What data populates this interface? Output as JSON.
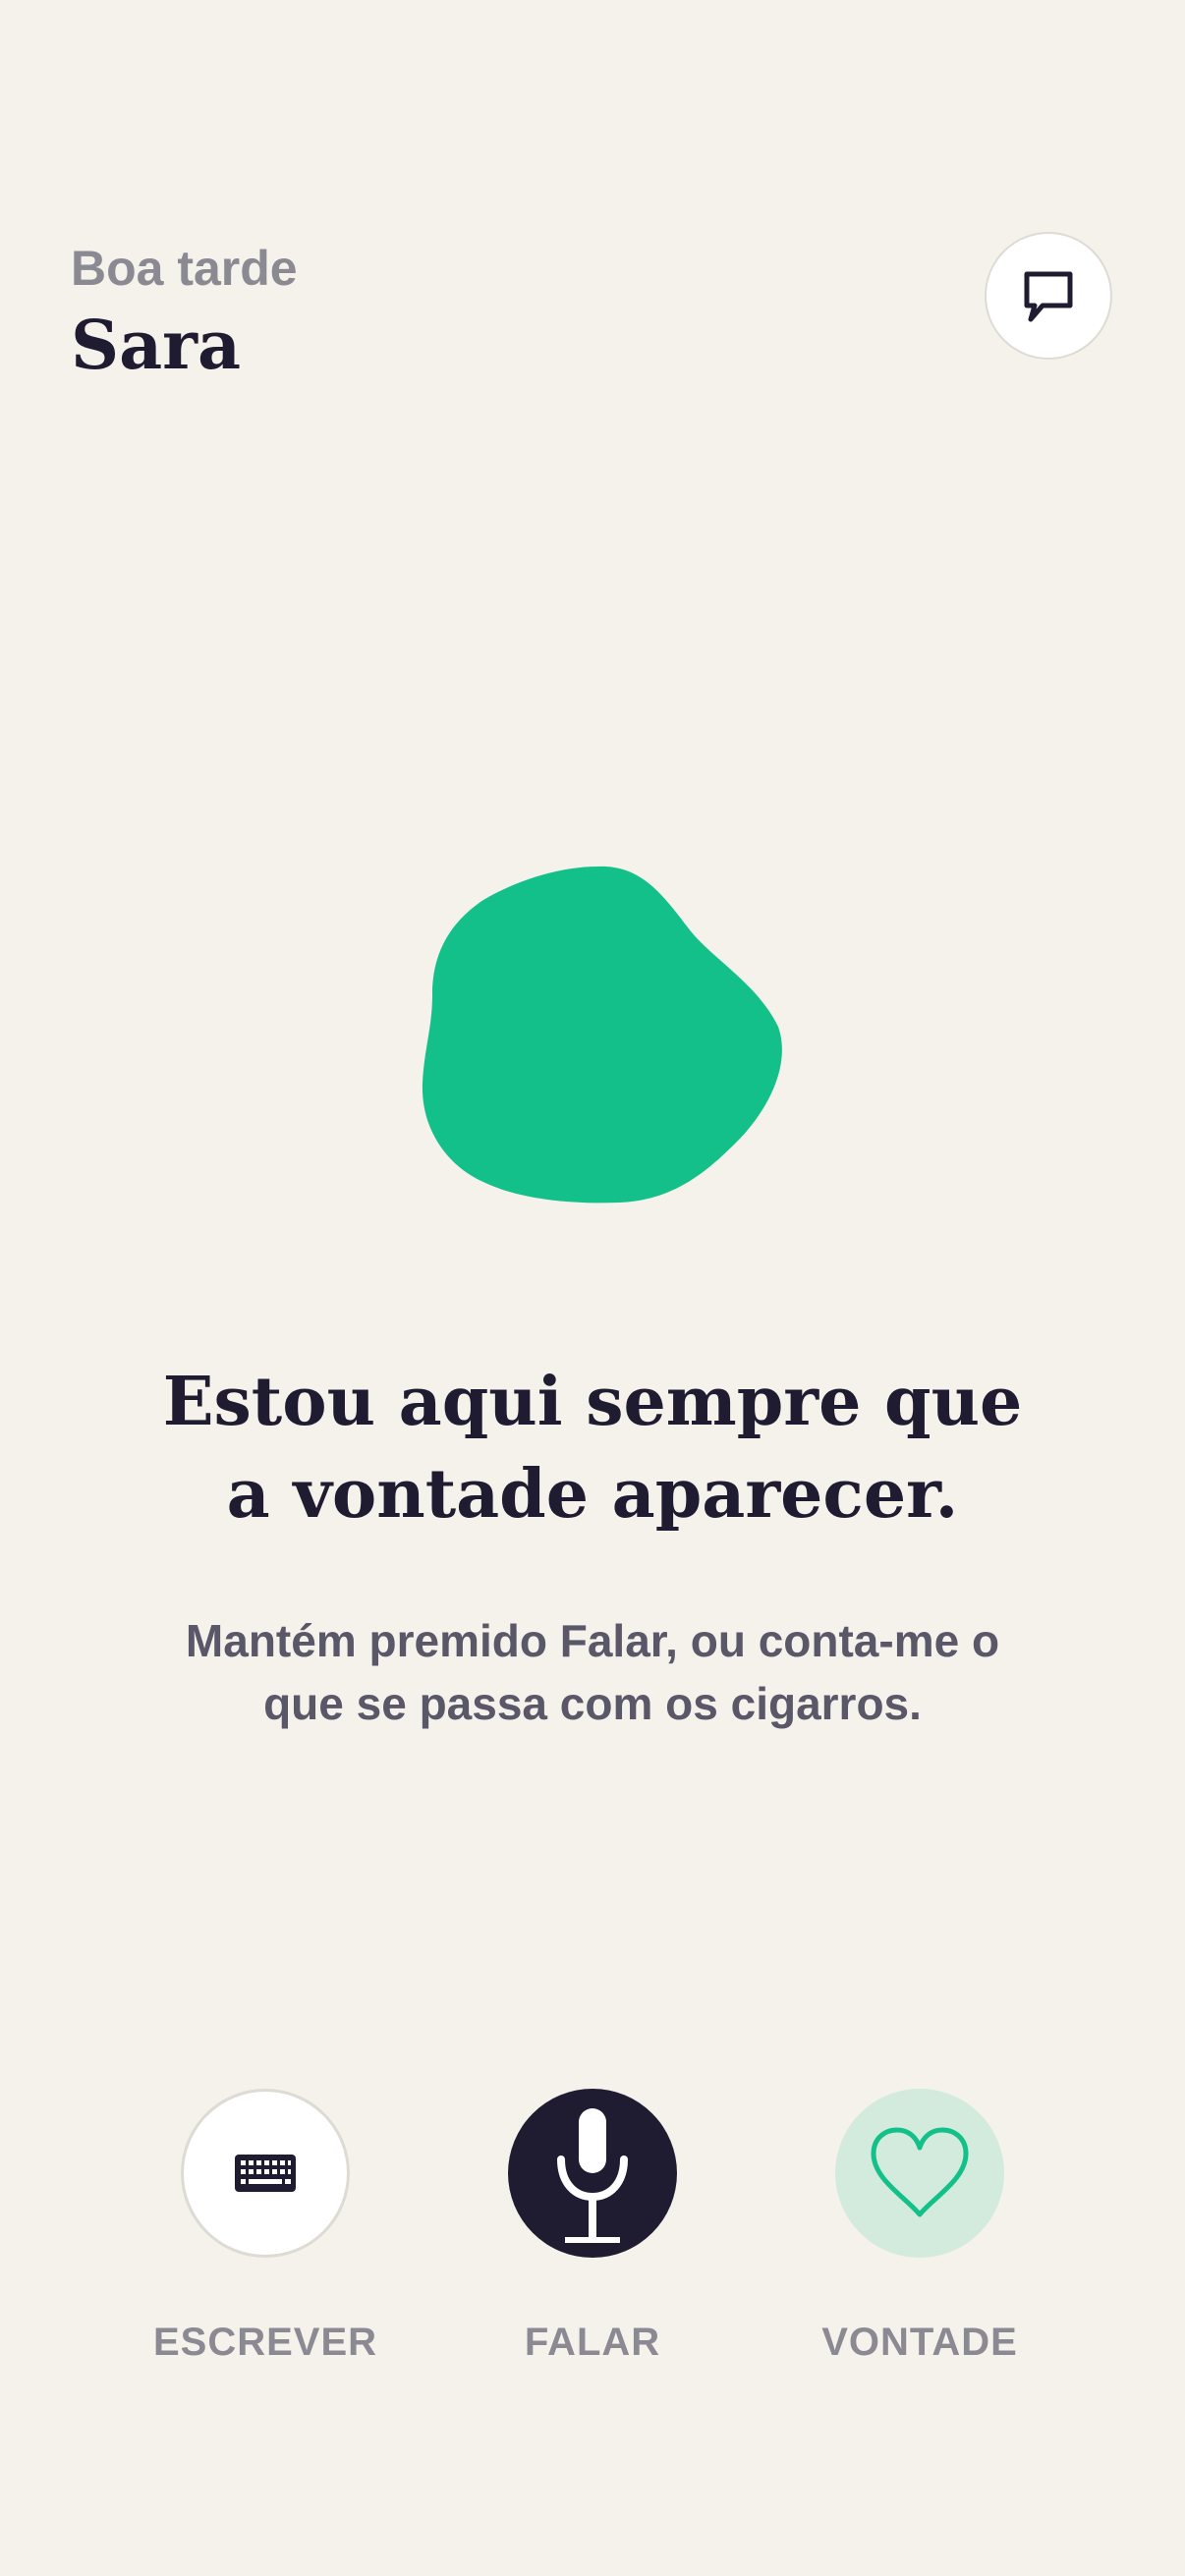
{
  "header": {
    "greeting": "Boa tarde",
    "user_name": "Sara",
    "chat_icon": "chat-bubble-icon"
  },
  "main": {
    "blob_color": "#14c08a",
    "headline_line1": "Estou aqui sempre que",
    "headline_line2": "a vontade aparecer.",
    "subtext_line1": "Mantém premido Falar, ou conta-me o",
    "subtext_line2": "que se passa com os cigarros."
  },
  "actions": {
    "write": {
      "label": "ESCREVER",
      "icon": "keyboard-icon"
    },
    "speak": {
      "label": "FALAR",
      "icon": "microphone-icon"
    },
    "craving": {
      "label": "VONTADE",
      "icon": "heart-icon"
    }
  },
  "colors": {
    "background": "#f5f2ec",
    "accent": "#14c08a",
    "dark": "#1f1c32",
    "muted": "#8b8a93"
  }
}
